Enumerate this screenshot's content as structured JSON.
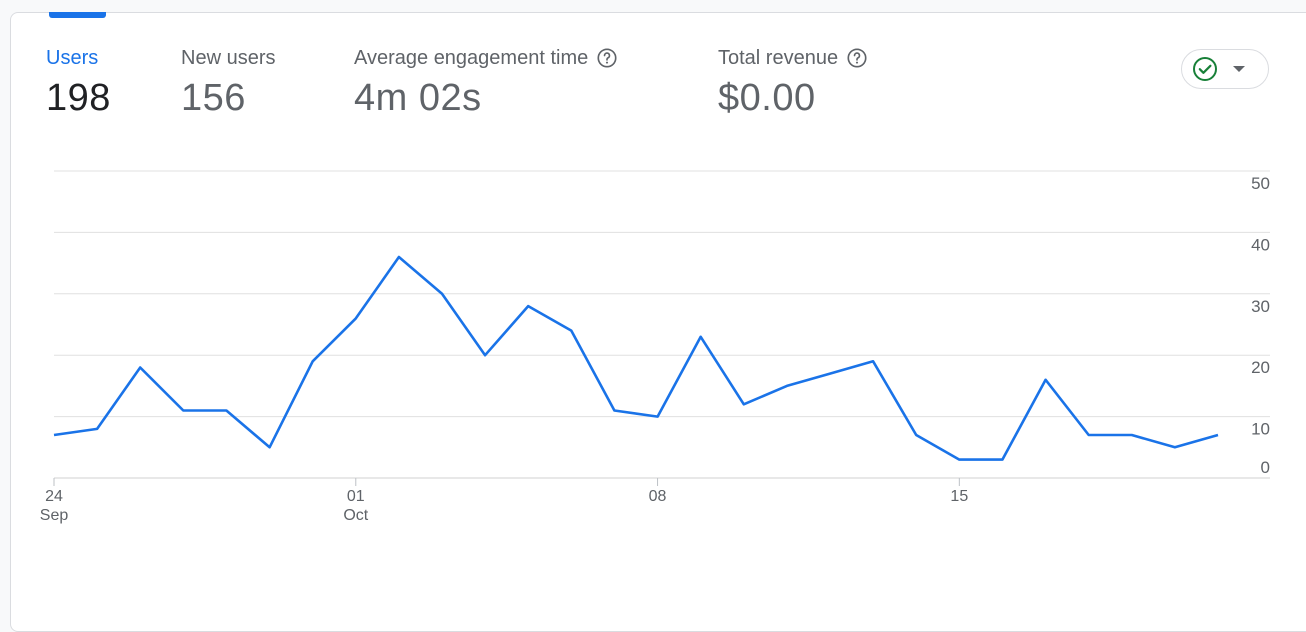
{
  "metrics": [
    {
      "label": "Users",
      "value": "198",
      "help": false,
      "active": true
    },
    {
      "label": "New users",
      "value": "156",
      "help": false,
      "active": false
    },
    {
      "label": "Average engagement time",
      "value": "4m 02s",
      "help": true,
      "active": false
    },
    {
      "label": "Total revenue",
      "value": "$0.00",
      "help": true,
      "active": false
    }
  ],
  "colors": {
    "accent": "#1a73e8",
    "check": "#188038",
    "grid": "#e0e0e0"
  },
  "icons": {
    "help": "help-circle-icon",
    "compare": "check-circle-icon",
    "dropdown": "caret-down-icon"
  },
  "chart_data": {
    "type": "line",
    "title": "",
    "xlabel": "",
    "ylabel": "",
    "ylim": [
      0,
      50
    ],
    "yticks": [
      0,
      10,
      20,
      30,
      40,
      50
    ],
    "x_tick_labels": [
      {
        "day": "24",
        "month": "Sep",
        "index": 0
      },
      {
        "day": "01",
        "month": "Oct",
        "index": 7
      },
      {
        "day": "08",
        "month": "",
        "index": 14
      },
      {
        "day": "15",
        "month": "",
        "index": 21
      }
    ],
    "x": [
      "Sep 24",
      "Sep 25",
      "Sep 26",
      "Sep 27",
      "Sep 28",
      "Sep 29",
      "Sep 30",
      "Oct 01",
      "Oct 02",
      "Oct 03",
      "Oct 04",
      "Oct 05",
      "Oct 06",
      "Oct 07",
      "Oct 08",
      "Oct 09",
      "Oct 10",
      "Oct 11",
      "Oct 12",
      "Oct 13",
      "Oct 14",
      "Oct 15",
      "Oct 16",
      "Oct 17",
      "Oct 18",
      "Oct 19",
      "Oct 20",
      "Oct 21"
    ],
    "series": [
      {
        "values": [
          7,
          8,
          18,
          11,
          11,
          5,
          19,
          26,
          36,
          30,
          20,
          28,
          24,
          11,
          10,
          23,
          12,
          15,
          17,
          19,
          7,
          3,
          3,
          16,
          7,
          7,
          5,
          7
        ]
      }
    ],
    "grid": true
  }
}
